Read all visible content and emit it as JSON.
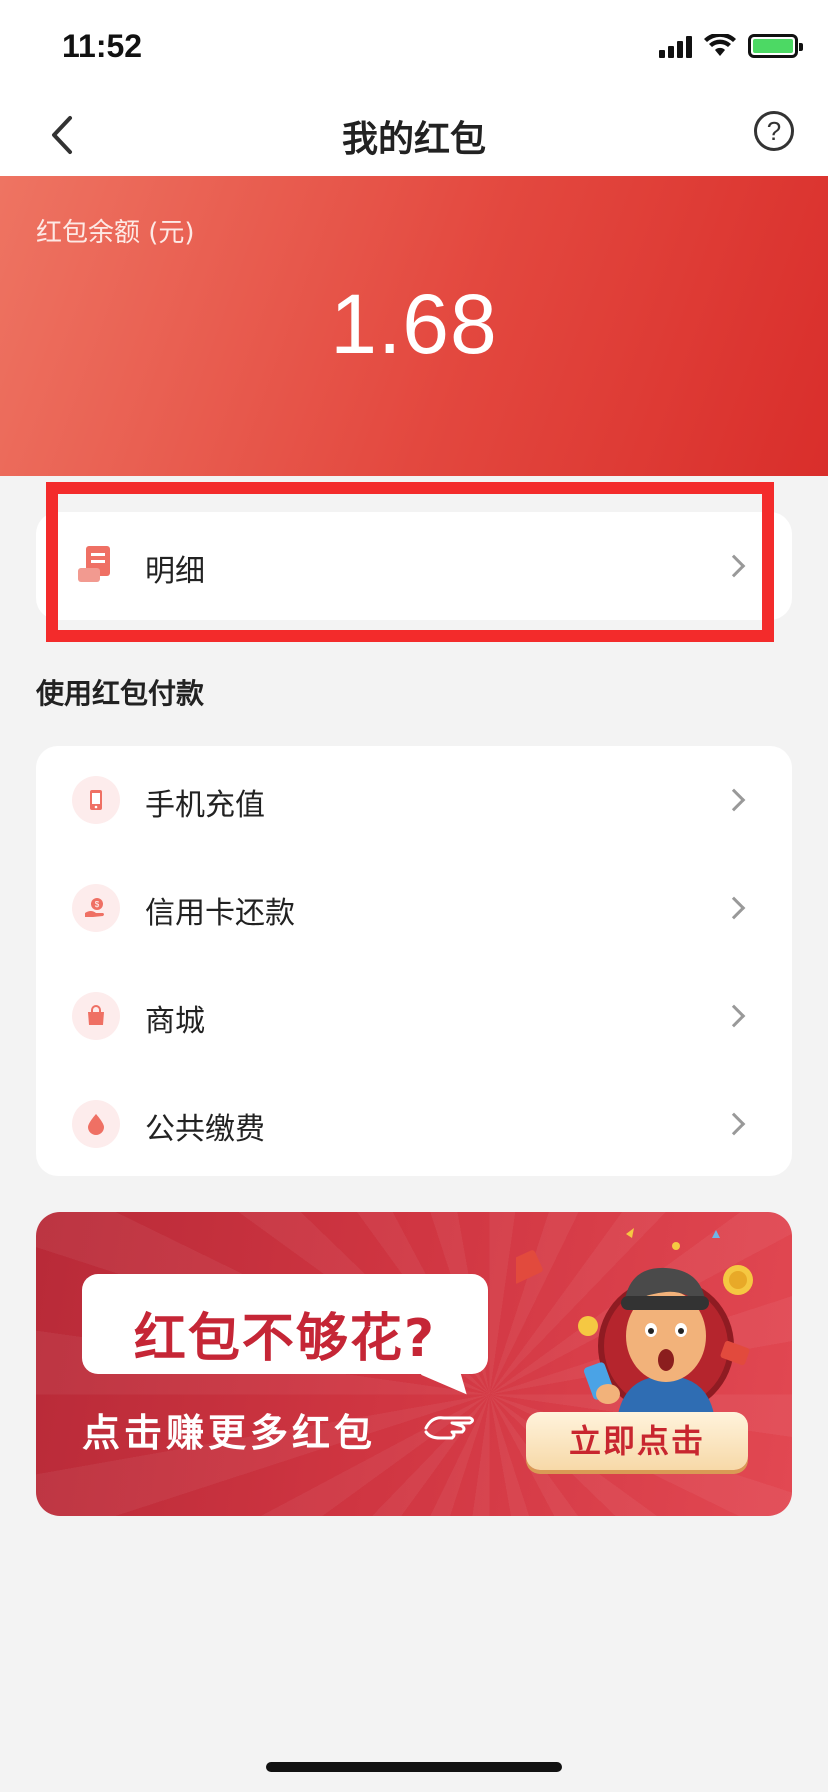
{
  "status_bar": {
    "time": "11:52",
    "icons": [
      "signal-icon",
      "wifi-icon",
      "battery-charging-icon"
    ],
    "battery_color": "#4cd964"
  },
  "nav": {
    "title": "我的红包",
    "back_icon": "chevron-left-icon",
    "help_icon": "question-circle-icon",
    "help_glyph": "?"
  },
  "balance": {
    "label": "红包余额 (元)",
    "value": "1.68"
  },
  "detail": {
    "label": "明细",
    "icon": "receipt-icon",
    "highlighted": true,
    "highlight_color": "#f32b2b"
  },
  "pay_section": {
    "title": "使用红包付款",
    "items": [
      {
        "label": "手机充值",
        "icon": "phone-icon"
      },
      {
        "label": "信用卡还款",
        "icon": "hand-coin-icon"
      },
      {
        "label": "商城",
        "icon": "shopping-bag-icon"
      },
      {
        "label": "公共缴费",
        "icon": "water-drop-icon"
      }
    ]
  },
  "banner": {
    "headline": "红包不够花?",
    "subtitle": "点击赚更多红包",
    "cta": "立即点击"
  },
  "colors": {
    "brand_red": "#e3483f",
    "icon_red": "#ef7064",
    "page_bg": "#f3f3f3"
  }
}
